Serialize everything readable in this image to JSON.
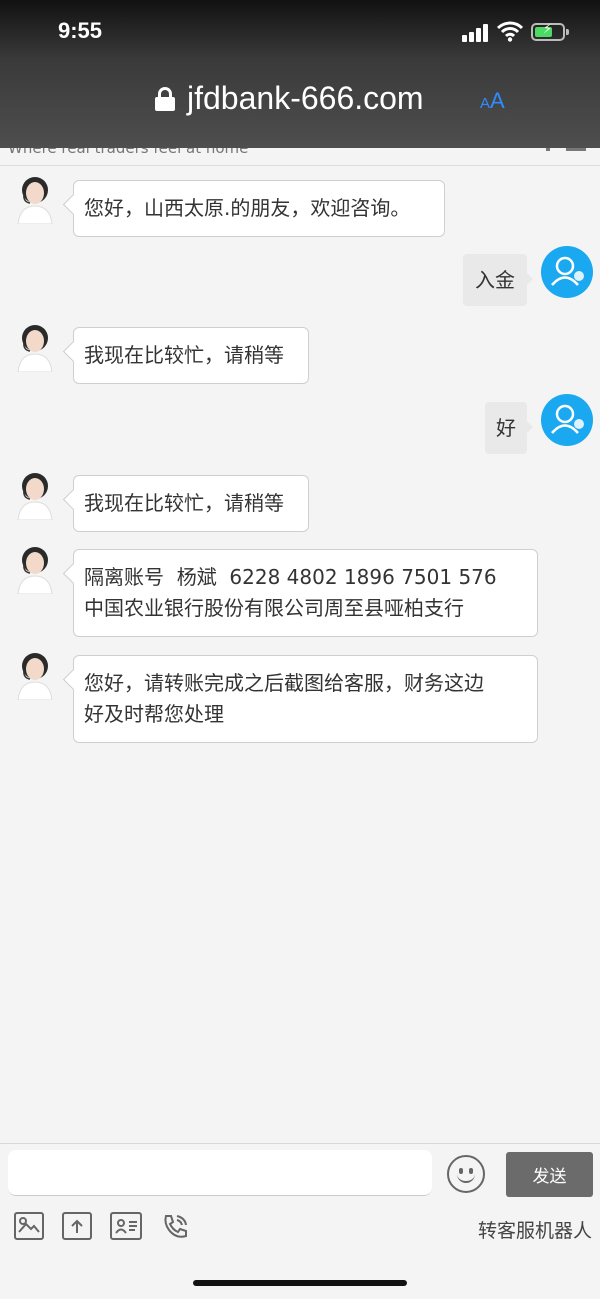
{
  "status_bar": {
    "time": "9:55"
  },
  "browser": {
    "url": "jfdbank-666.com",
    "text_size_small": "A",
    "text_size_large": "A"
  },
  "site": {
    "tagline": "Where real traders feel at home"
  },
  "messages": [
    {
      "from": "agent",
      "lines": [
        "您好，山西太原.的朋友，欢迎咨询。"
      ]
    },
    {
      "from": "user",
      "text": "入金"
    },
    {
      "from": "agent",
      "lines": [
        "我现在比较忙，请稍等"
      ]
    },
    {
      "from": "user",
      "text": "好"
    },
    {
      "from": "agent",
      "lines": [
        "我现在比较忙，请稍等"
      ]
    },
    {
      "from": "agent",
      "lines": [
        "隔离账号  杨斌  6228 4802 1896 7501 576",
        "中国农业银行股份有限公司周至县哑柏支行"
      ]
    },
    {
      "from": "agent",
      "lines": [
        "您好，请转账完成之后截图给客服，财务这边",
        "好及时帮您处理"
      ]
    }
  ],
  "composer": {
    "send_label": "发送",
    "emoji_icon": "smiley-icon"
  },
  "toolbar": {
    "icons": [
      "image-icon",
      "upload-file-icon",
      "id-card-icon",
      "phone-icon"
    ],
    "robot_label": "转客服机器人"
  },
  "colors": {
    "user_avatar": "#1aa8f0",
    "send_button": "#6b6b6b",
    "top_bar": "#3a3a3a"
  }
}
